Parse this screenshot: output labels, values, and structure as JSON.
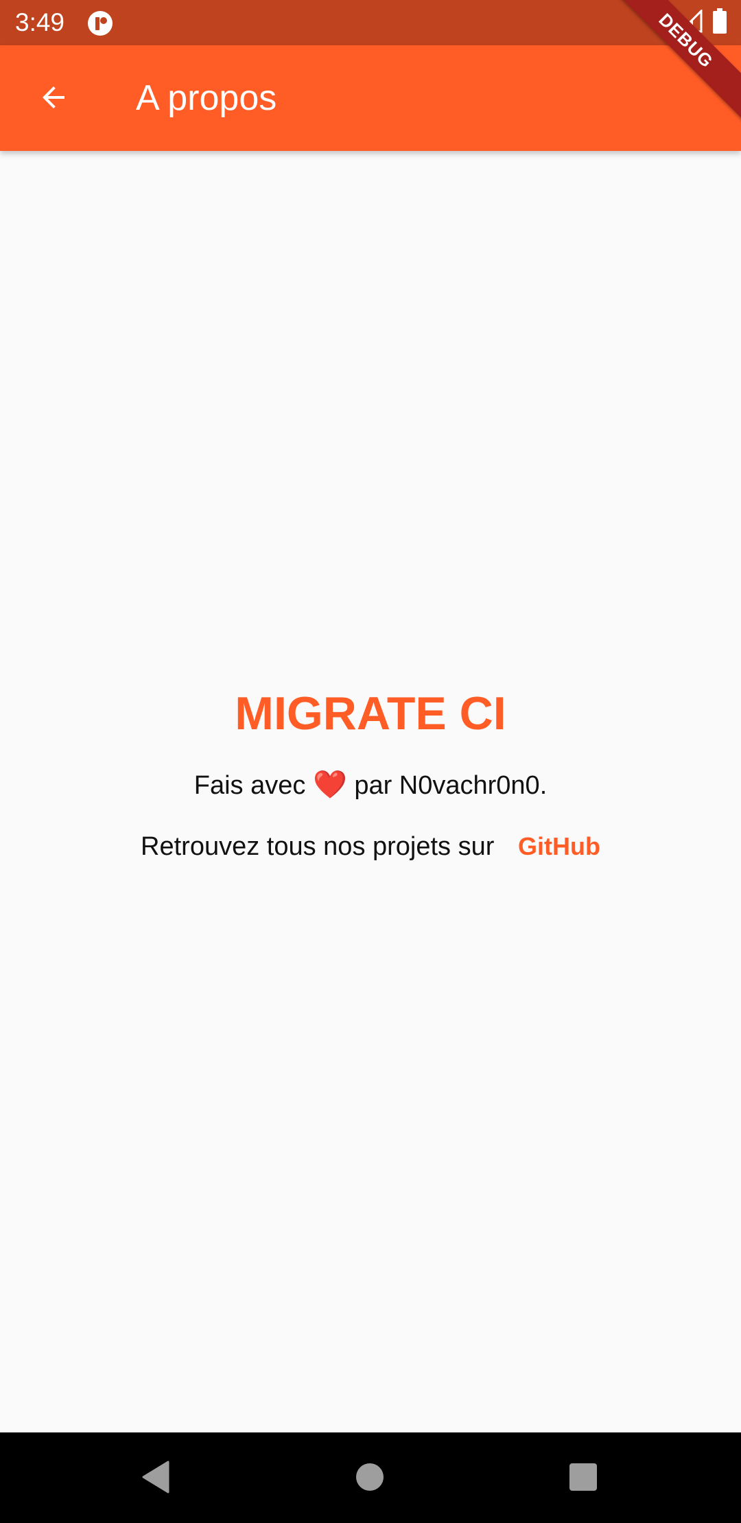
{
  "status_bar": {
    "time": "3:49",
    "icons": [
      "app-notification-icon",
      "wifi-icon",
      "signal-icon",
      "battery-icon"
    ]
  },
  "app_bar": {
    "title": "A propos",
    "back_icon": "arrow-back-icon"
  },
  "debug_banner": {
    "label": "DEBUG"
  },
  "about": {
    "app_name": "MIGRATE CI",
    "credit_prefix": "Fais avec",
    "heart": "❤️",
    "credit_suffix": "par N0vachr0n0.",
    "projects_text": "Retrouvez tous nos projets sur",
    "github_label": "GitHub"
  },
  "nav_bar": {
    "icons": [
      "back-triangle-icon",
      "home-circle-icon",
      "recents-square-icon"
    ]
  },
  "colors": {
    "primary": "#ff5c26",
    "status_bar": "#bf431e",
    "background": "#fafafa",
    "debug_banner": "#a3201d"
  }
}
